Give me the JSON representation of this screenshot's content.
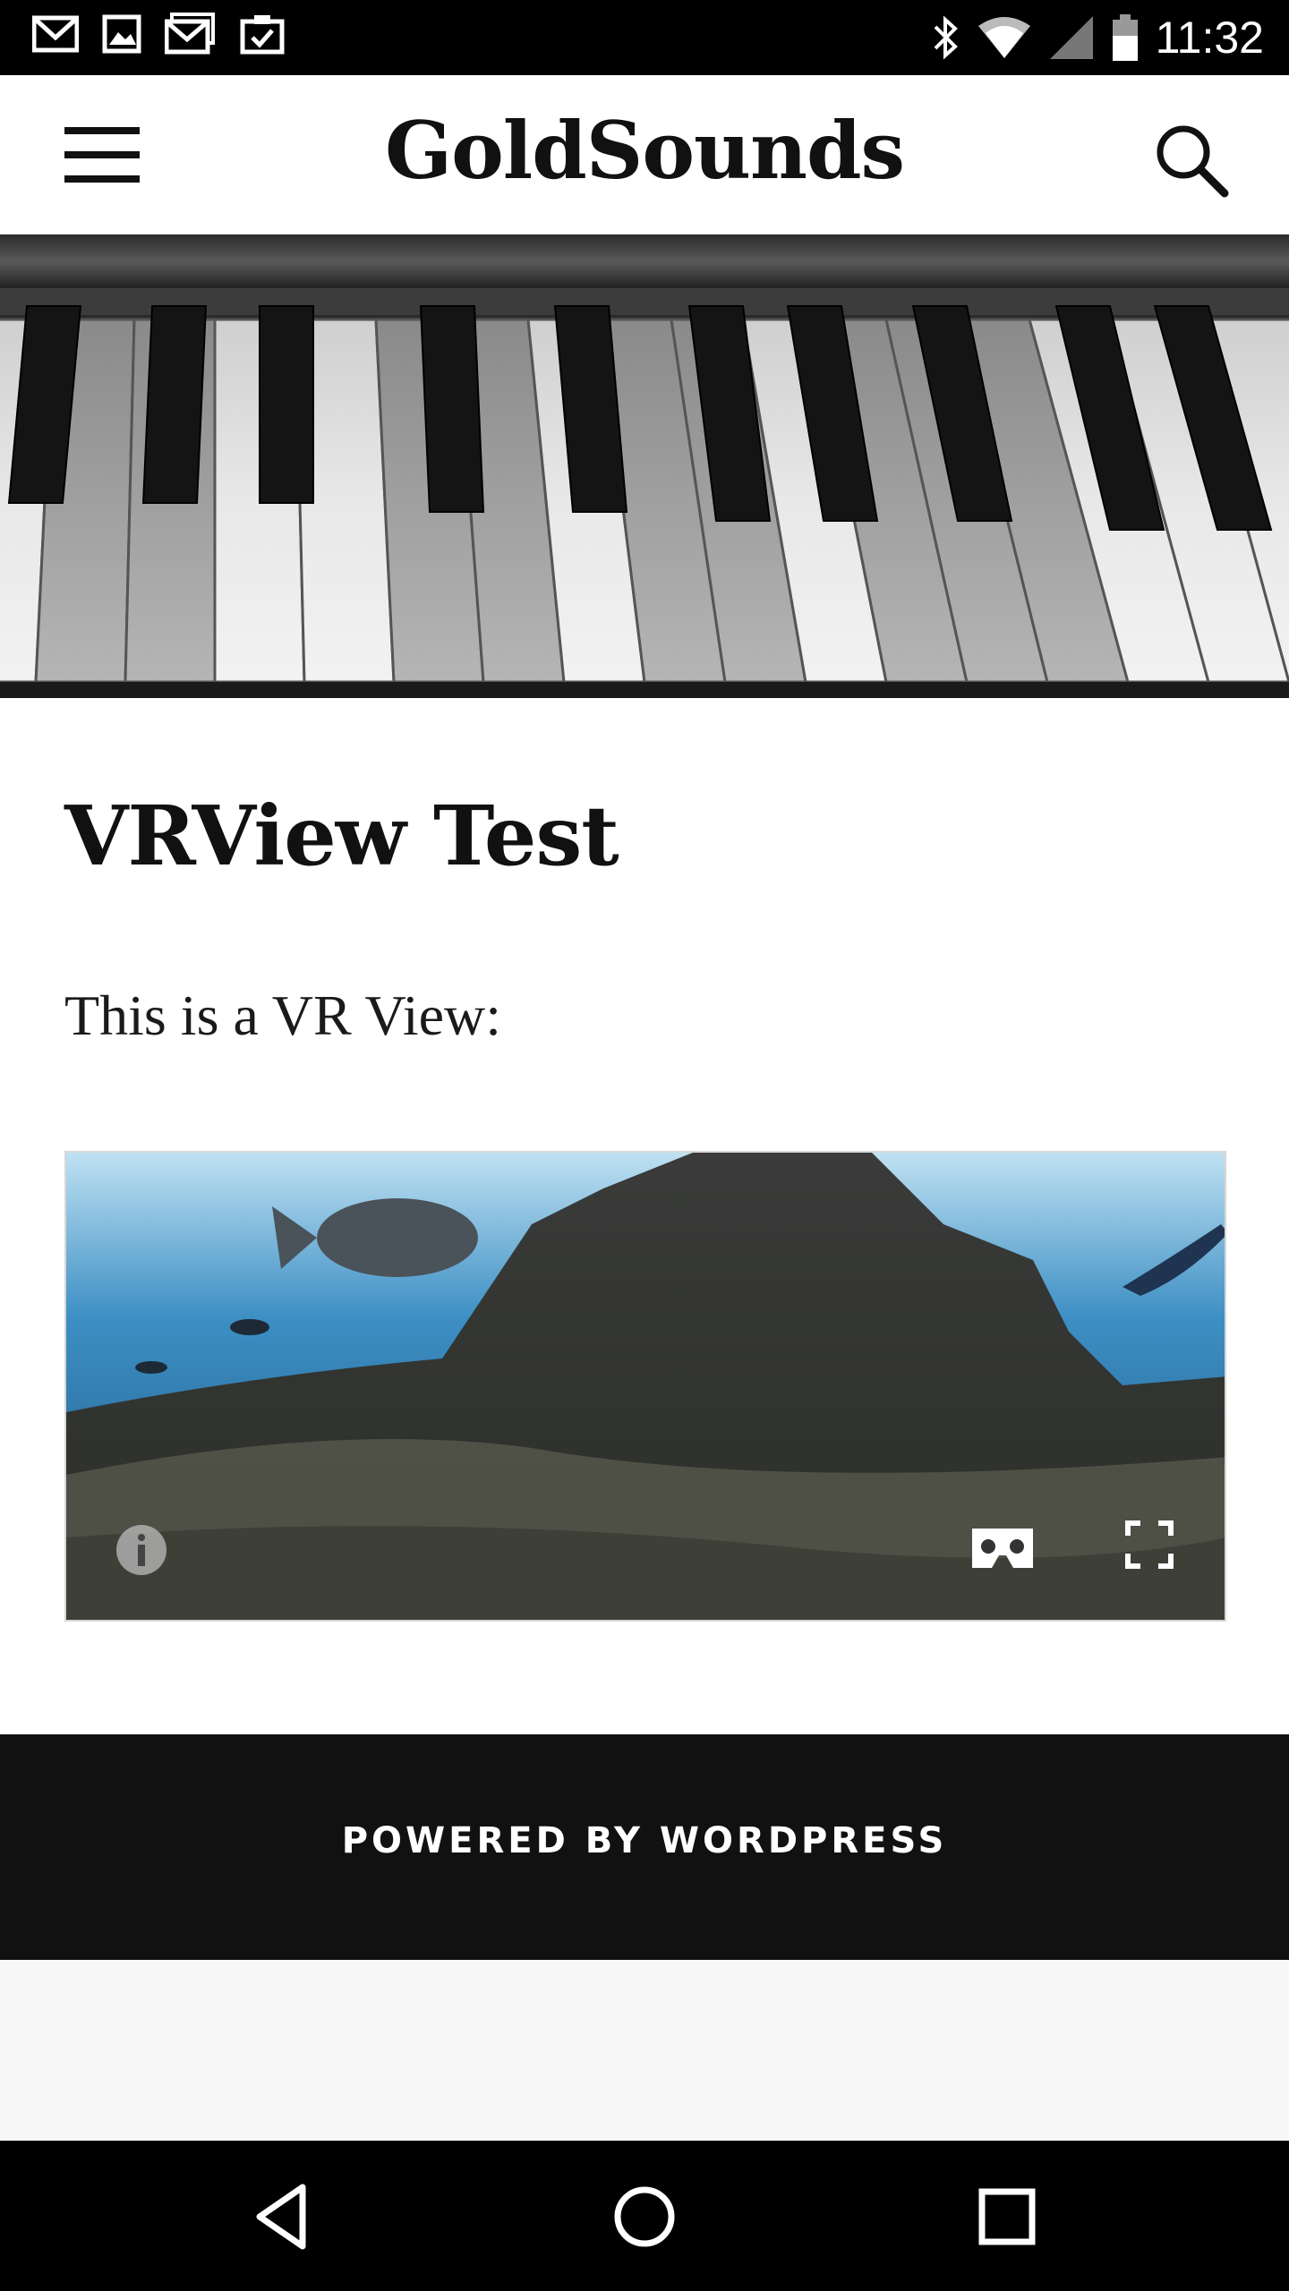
{
  "status_bar": {
    "time": "11:32",
    "left_icons": [
      "gmail-icon",
      "image-icon",
      "gmail-icon",
      "clipboard-check-icon"
    ],
    "right_icons": [
      "bluetooth-icon",
      "wifi-icon",
      "signal-icon",
      "battery-icon"
    ]
  },
  "header": {
    "site_title": "GoldSounds",
    "menu_icon": "hamburger-menu-icon",
    "search_icon": "search-icon"
  },
  "hero": {
    "image": "piano-keys-photo"
  },
  "post": {
    "title": "VRView Test",
    "text": "This is a VR View:"
  },
  "vr_view": {
    "image": "underwater-reef-panorama",
    "controls": [
      "info-icon",
      "cardboard-vr-icon",
      "fullscreen-icon"
    ]
  },
  "footer": {
    "text": "POWERED BY WORDPRESS"
  },
  "nav_bar": {
    "buttons": [
      "back-icon",
      "home-icon",
      "recents-icon"
    ]
  },
  "colors": {
    "status_bar_bg": "#000000",
    "footer_bg": "#111111",
    "page_bg": "#ffffff"
  }
}
